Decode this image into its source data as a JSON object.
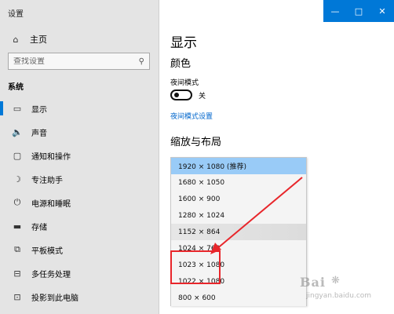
{
  "app": {
    "title": "设置"
  },
  "sidebar": {
    "home_label": "主页",
    "search_placeholder": "查找设置",
    "section": "系统",
    "items": [
      {
        "icon": "display-icon",
        "label": "显示"
      },
      {
        "icon": "sound-icon",
        "label": "声音"
      },
      {
        "icon": "notification-icon",
        "label": "通知和操作"
      },
      {
        "icon": "focus-assist-icon",
        "label": "专注助手"
      },
      {
        "icon": "power-icon",
        "label": "电源和睡眠"
      },
      {
        "icon": "storage-icon",
        "label": "存储"
      },
      {
        "icon": "tablet-icon",
        "label": "平板模式"
      },
      {
        "icon": "multitasking-icon",
        "label": "多任务处理"
      },
      {
        "icon": "project-icon",
        "label": "投影到此电脑"
      }
    ]
  },
  "window_controls": {
    "minimize": "—",
    "maximize": "□",
    "close": "✕"
  },
  "main": {
    "title": "显示",
    "color_header": "颜色",
    "night_light_label": "夜间模式",
    "toggle_state": "关",
    "night_light_link": "夜间模式设置",
    "scale_header": "缩放与布局"
  },
  "resolution_list": {
    "items": [
      "1920 × 1080 (推荐)",
      "1680 × 1050",
      "1600 × 900",
      "1280 × 1024",
      "1152 × 864",
      "1024 × 768",
      "1023 × 1080",
      "1022 × 1080",
      "800 × 600"
    ],
    "selected_index": 0
  },
  "watermark": {
    "main": "Bai",
    "paw": "❋",
    "sub": "jingyan.baidu.com"
  },
  "colors": {
    "accent": "#0078d7",
    "highlight": "#e8262b",
    "selected": "#99cbf7"
  }
}
